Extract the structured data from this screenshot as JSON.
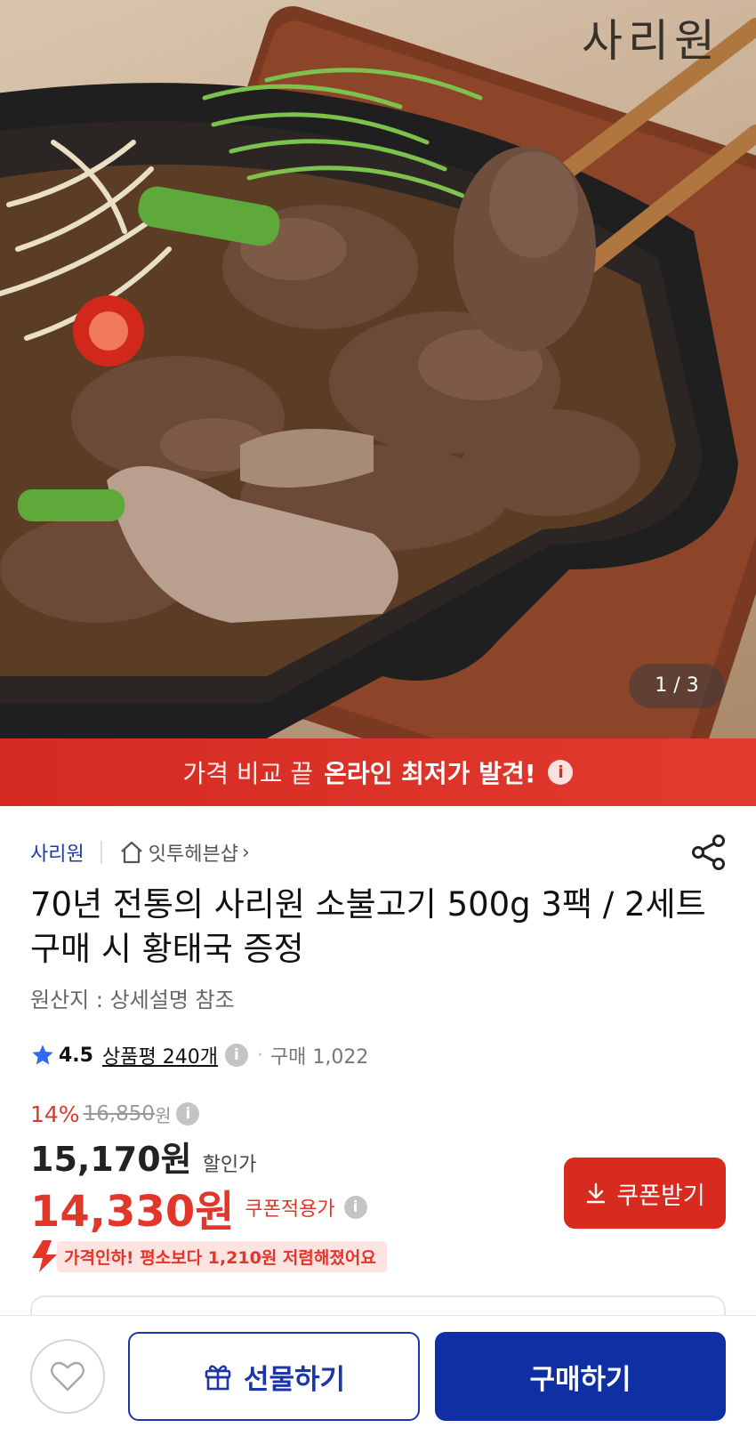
{
  "hero": {
    "brand_logo": "사리원",
    "image_counter": "1 / 3"
  },
  "promo": {
    "text_light": "가격 비교 끝",
    "text_bold": "온라인 최저가 발견!",
    "info_glyph": "i"
  },
  "store": {
    "seller": "사리원",
    "shop": "잇투헤븐샵",
    "chevron": "›"
  },
  "product": {
    "title": "70년 전통의 사리원 소불고기 500g 3팩 / 2세트 구매 시 황태국 증정",
    "origin": "원산지 : 상세설명 참조"
  },
  "rating": {
    "score": "4.5",
    "reviews": "상품평 240개",
    "dot": "·",
    "purchase_count": "구매 1,022"
  },
  "price": {
    "discount_rate": "14%",
    "original": "16,850",
    "original_unit": "원",
    "sale": "15,170원",
    "sale_label": "할인가",
    "coupon_price": "14,330원",
    "coupon_label": "쿠폰적용가",
    "coupon_button": "쿠폰받기",
    "drop_text": "가격인하! 평소보다 1,210원 저렴해졌어요"
  },
  "bottom_bar": {
    "gift": "선물하기",
    "buy": "구매하기"
  },
  "colors": {
    "accent_red": "#d82b20",
    "brand_blue": "#0f2fa3",
    "seller_blue": "#1e3aa8"
  }
}
